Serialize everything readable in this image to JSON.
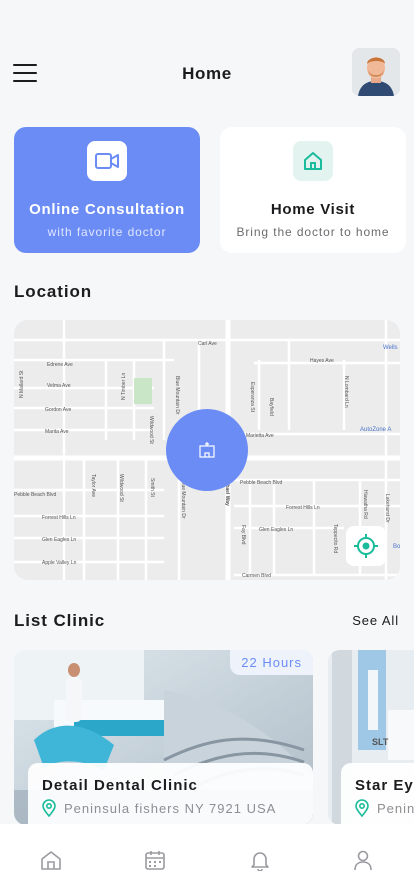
{
  "header": {
    "title": "Home"
  },
  "services": [
    {
      "title": "Online Consultation",
      "subtitle": "with favorite doctor",
      "icon": "video-camera-icon"
    },
    {
      "title": "Home Visit",
      "subtitle": "Bring the doctor to home",
      "icon": "house-icon"
    }
  ],
  "location": {
    "title": "Location",
    "map_labels": {
      "carl_ave": "Carl Ave",
      "hayes_ave": "Hayes Ave",
      "wells": "Wells",
      "edrene_ave": "Edrene Ave",
      "velma_ave": "Velma Ave",
      "gordon_ave": "Gordon Ave",
      "marita_ave": "Marita Ave",
      "marietta_ave": "Marietta Ave",
      "autozone": "AutoZone A",
      "pebble_beach_blvd_1": "Pebble Beach Blvd",
      "pebble_beach_blvd_2": "Pebble Beach Blvd",
      "forrest_hills_ln_1": "Forrest Hills Ln",
      "forrest_hills_ln_2": "Forrest Hills Ln",
      "glen_eagles_ln_1": "Glen Eagles Ln",
      "glen_eagles_ln_2": "Glen Eagles Ln",
      "apple_valley_ln": "Apple Valley Ln",
      "carmen_blvd": "Carmen Blvd",
      "n_mallard_st": "N Mallard St",
      "n_timber_ln": "N Timber Ln",
      "blue_mountain_dr_1": "Blue Mountain Dr",
      "blue_mountain_dr_2": "Blue Mountain Dr",
      "esperanza_st": "Esperanza St",
      "n_lombard_ln": "N Lombard Ln",
      "wildwood_st_1": "Wildwood St",
      "wildwood_st_2": "Wildwood St",
      "taylor_ave": "Taylor Ave",
      "smith_st": "Smith St",
      "lakehurst_dr": "Lakehurst Dr",
      "hiawatha_rd": "Hiawatha Rd",
      "fay_blvd": "Fay Blvd",
      "teppecito_rd": "Teppecito Rd",
      "bayfield": "Bayfield",
      "michael_way": "Michael Way",
      "bo": "Bo"
    }
  },
  "clinics": {
    "title": "List Clinic",
    "see_all": "See All",
    "items": [
      {
        "name": "Detail Dental Clinic",
        "address": "Peninsula fishers NY 7921 USA",
        "hours": "22 Hours"
      },
      {
        "name": "Star Eye",
        "address": "Penin"
      }
    ]
  },
  "tabs": [
    {
      "name": "home",
      "icon": "home-icon"
    },
    {
      "name": "calendar",
      "icon": "calendar-icon"
    },
    {
      "name": "notifications",
      "icon": "bell-icon"
    },
    {
      "name": "profile",
      "icon": "user-icon"
    }
  ],
  "colors": {
    "accent": "#6b8cf5",
    "teal": "#1abc9c",
    "background": "#f6f7f9"
  }
}
